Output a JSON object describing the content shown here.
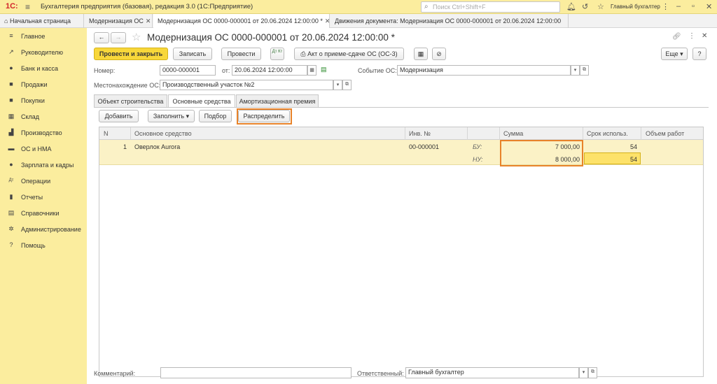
{
  "titlebar": {
    "logo": "1С:",
    "title": "Бухгалтерия предприятия (базовая), редакция 3.0  (1С:Предприятие)",
    "search_placeholder": "Поиск Ctrl+Shift+F",
    "user": "Главный бухгалтер"
  },
  "tabs": [
    {
      "label": "Начальная страница"
    },
    {
      "label": "Модернизация ОС"
    },
    {
      "label": "Модернизация ОС 0000-000001 от 20.06.2024 12:00:00 *"
    },
    {
      "label": "Движения документа: Модернизация ОС 0000-000001 от 20.06.2024 12:00:00"
    }
  ],
  "sidebar": {
    "items": [
      {
        "label": "Главное",
        "icon": "≡"
      },
      {
        "label": "Руководителю",
        "icon": "↗"
      },
      {
        "label": "Банк и касса",
        "icon": "●"
      },
      {
        "label": "Продажи",
        "icon": "■"
      },
      {
        "label": "Покупки",
        "icon": "■"
      },
      {
        "label": "Склад",
        "icon": "▦"
      },
      {
        "label": "Производство",
        "icon": "▟"
      },
      {
        "label": "ОС и НМА",
        "icon": "▬"
      },
      {
        "label": "Зарплата и кадры",
        "icon": "●"
      },
      {
        "label": "Операции",
        "icon": "Дт"
      },
      {
        "label": "Отчеты",
        "icon": "▮"
      },
      {
        "label": "Справочники",
        "icon": "▤"
      },
      {
        "label": "Администрирование",
        "icon": "✲"
      },
      {
        "label": "Помощь",
        "icon": "?"
      }
    ]
  },
  "doc": {
    "title": "Модернизация ОС 0000-000001 от 20.06.2024 12:00:00 *",
    "btn_post_close": "Провести и закрыть",
    "btn_save": "Записать",
    "btn_post": "Провести",
    "btn_dtkt": "Дт Кт",
    "btn_act": "Акт о приеме-сдаче ОС (ОС-3)",
    "btn_more": "Еще",
    "btn_help": "?",
    "number_label": "Номер:",
    "number_value": "0000-000001",
    "date_label": "от:",
    "date_value": "20.06.2024 12:00:00",
    "event_label": "Событие ОС:",
    "event_value": "Модернизация",
    "location_label": "Местонахождение ОС:",
    "location_value": "Производственный участок №2"
  },
  "form_tabs": [
    {
      "label": "Объект строительства"
    },
    {
      "label": "Основные средства"
    },
    {
      "label": "Амортизационная премия"
    }
  ],
  "table_toolbar": {
    "add": "Добавить",
    "fill": "Заполнить",
    "select": "Подбор",
    "distribute": "Распределить"
  },
  "table": {
    "headers": [
      "N",
      "Основное средство",
      "Инв. №",
      "",
      "Сумма",
      "Срок использ.",
      "Объем работ"
    ],
    "rows": [
      {
        "n": "1",
        "asset": "Оверлок Aurora",
        "inv": "00-000001",
        "bu_label": "БУ:",
        "nu_label": "НУ:",
        "sum_bu": "7 000,00",
        "sum_nu": "8 000,00",
        "term_bu": "54",
        "term_nu": "54"
      }
    ]
  },
  "footer": {
    "comment_label": "Комментарий:",
    "comment_value": "",
    "responsible_label": "Ответственный:",
    "responsible_value": "Главный бухгалтер"
  },
  "colors": {
    "accent": "#f8d73a",
    "sidebar": "#fbed9e",
    "highlight": "#e8832a"
  }
}
